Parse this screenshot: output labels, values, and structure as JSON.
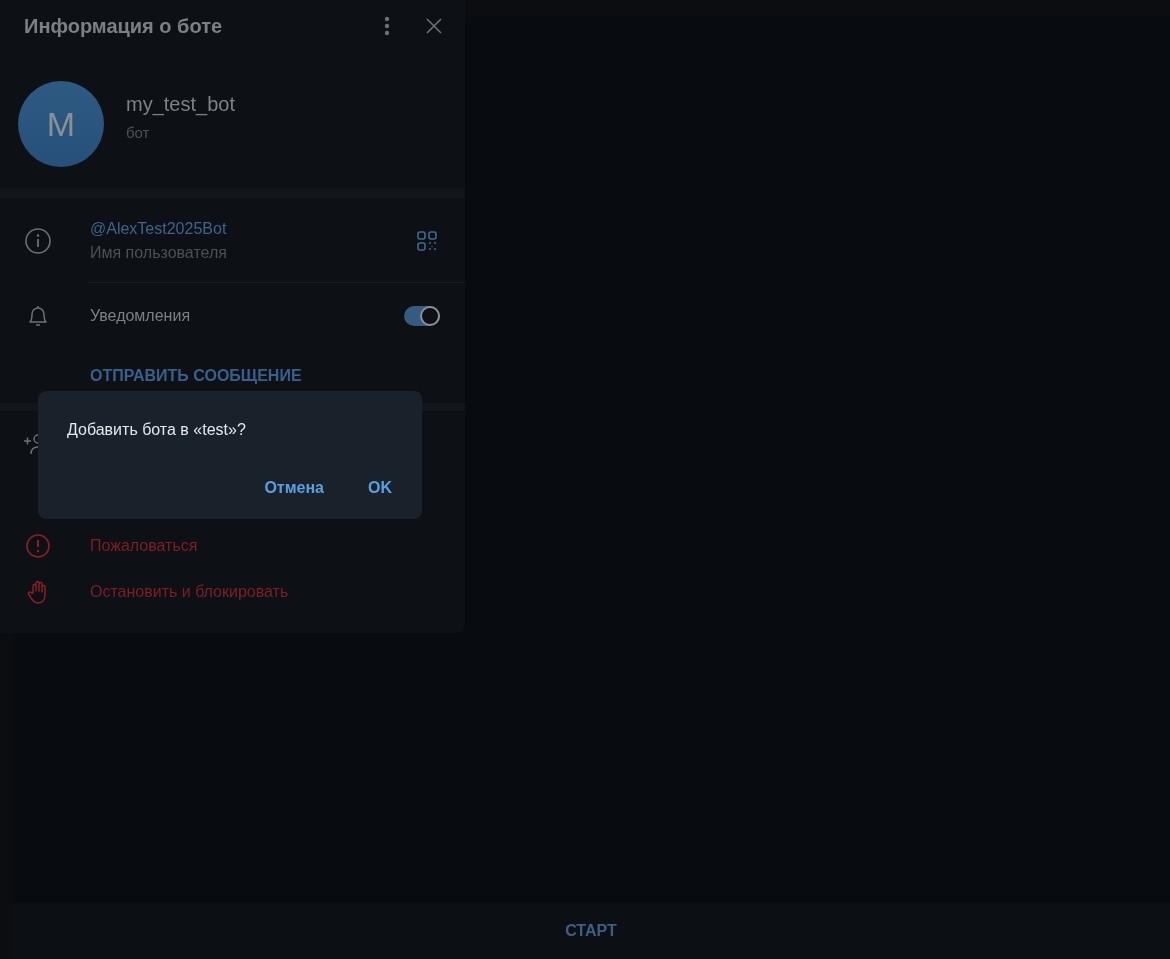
{
  "panel": {
    "title": "Информация о боте",
    "profile": {
      "avatar_letter": "M",
      "name": "my_test_bot",
      "subtitle": "бот"
    },
    "username": {
      "value": "@AlexTest2025Bot",
      "label": "Имя пользователя"
    },
    "notifications": {
      "label": "Уведомления",
      "on": true
    },
    "send_message": "ОТПРАВИТЬ СООБЩЕНИЕ",
    "actions": [
      {
        "kind": "report",
        "label": "Пожаловаться"
      },
      {
        "kind": "block",
        "label": "Остановить и блокировать"
      }
    ]
  },
  "dialog": {
    "message": "Добавить бота в «test»?",
    "buttons": [
      "Отмена",
      "OK"
    ]
  },
  "chat": {
    "start_button": "СТАРТ"
  }
}
